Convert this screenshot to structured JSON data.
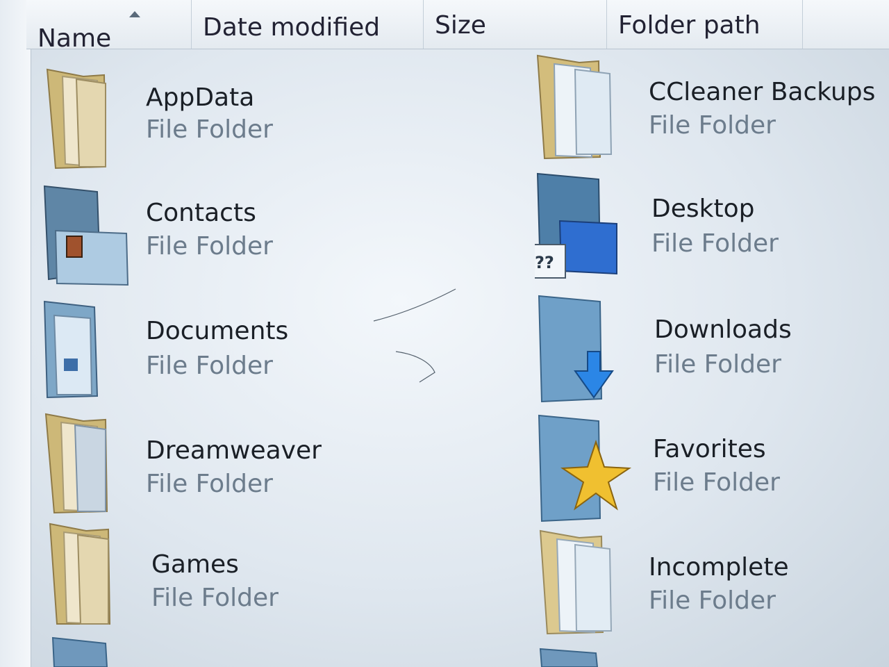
{
  "header": {
    "columns": [
      "Name",
      "Date modified",
      "Size",
      "Folder path"
    ]
  },
  "items": [
    {
      "name": "AppData",
      "type": "File Folder",
      "icon": "folder-icon"
    },
    {
      "name": "CCleaner Backups",
      "type": "File Folder",
      "icon": "folder-icon"
    },
    {
      "name": "Contacts",
      "type": "File Folder",
      "icon": "contacts-folder-icon"
    },
    {
      "name": "Desktop",
      "type": "File Folder",
      "icon": "desktop-folder-icon"
    },
    {
      "name": "Documents",
      "type": "File Folder",
      "icon": "documents-folder-icon"
    },
    {
      "name": "Downloads",
      "type": "File Folder",
      "icon": "downloads-folder-icon"
    },
    {
      "name": "Dreamweaver",
      "type": "File Folder",
      "icon": "folder-icon"
    },
    {
      "name": "Favorites",
      "type": "File Folder",
      "icon": "favorites-folder-icon"
    },
    {
      "name": "Games",
      "type": "File Folder",
      "icon": "folder-icon"
    },
    {
      "name": "Incomplete",
      "type": "File Folder",
      "icon": "folder-icon"
    }
  ],
  "colors": {
    "folder_tan": "#d9c48a",
    "folder_blue": "#6fa0c8",
    "accent_blue": "#2b6fd6",
    "star_gold": "#f0c030"
  }
}
